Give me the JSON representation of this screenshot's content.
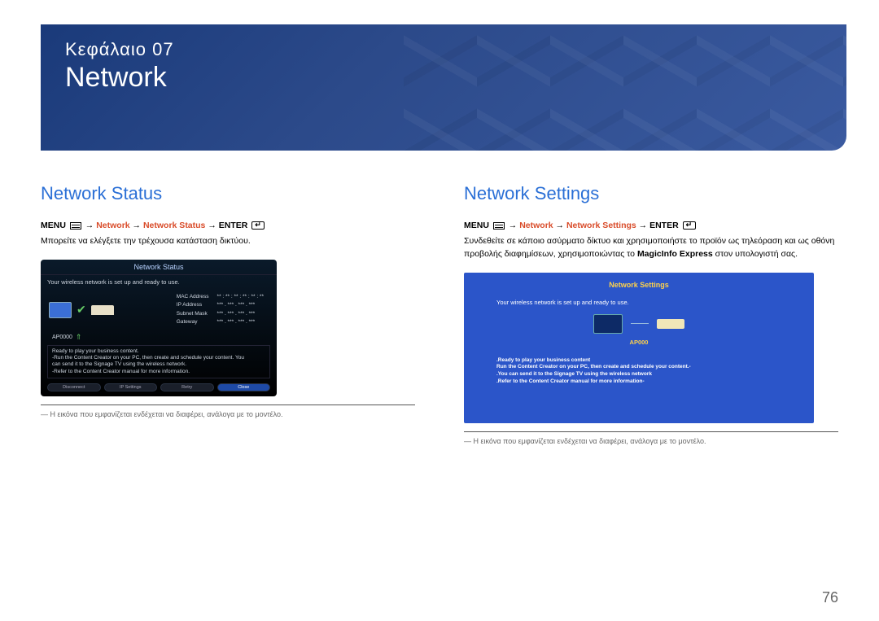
{
  "chapter": {
    "label": "Κεφάλαιο  07",
    "title": "Network"
  },
  "left": {
    "heading": "Network Status",
    "breadcrumb": {
      "menu": "MENU",
      "path": "Network",
      "item": "Network Status",
      "enter": "ENTER"
    },
    "desc": "Μπορείτε να ελέγξετε την τρέχουσα κατάσταση δικτύου.",
    "shot": {
      "title": "Network Status",
      "status_line": "Your wireless network is set up and ready to use.",
      "ap": "AP0000",
      "fields": {
        "mac": "MAC Address",
        "ip": "IP Address",
        "subnet": "Subnet Mask",
        "gateway": "Gateway"
      },
      "values": {
        "mac": "** : ** : ** : ** : ** : **",
        "ip": "*** . *** . *** . ***",
        "subnet": "*** . *** . *** . ***",
        "gateway": "*** . *** . *** . ***"
      },
      "ready_title": "Ready to play your business content.",
      "ready_l1": "-Run the Content Creator on your PC, then create and schedule your content. You",
      "ready_l2": "can send it to the Signage TV using the wireless network.",
      "ready_l3": "-Refer to the Content Creator manual for more information.",
      "btn_disconnect": "Disconnect",
      "btn_ip": "IP Settings",
      "btn_retry": "Retry",
      "btn_close": "Close"
    },
    "footnote": "― Η εικόνα που εμφανίζεται ενδέχεται να διαφέρει, ανάλογα με το μοντέλο."
  },
  "right": {
    "heading": "Network Settings",
    "breadcrumb": {
      "menu": "MENU",
      "path": "Network",
      "item": "Network Settings",
      "enter": "ENTER"
    },
    "desc_pre": "Συνδεθείτε σε κάποιο ασύρματο δίκτυο και χρησιμοποιήστε το προϊόν ως τηλεόραση και ως οθόνη προβολής διαφημίσεων, χρησιμοποιώντας το ",
    "desc_bold": "MagicInfo Express",
    "desc_post": " στον υπολογιστή σας.",
    "shot": {
      "title": "Network Settings",
      "status_line": "Your wireless network is set up and ready to use.",
      "ap": "AP000",
      "ready_title": ".Ready to play your business content",
      "ready_l1": "Run the Content Creator on your PC, then create and schedule your content.-",
      "ready_l2": ".You can send it to the Signage TV using the wireless network",
      "ready_l3": ".Refer to the Content Creator manual for more information-"
    },
    "footnote": "― Η εικόνα που εμφανίζεται ενδέχεται να διαφέρει, ανάλογα με το μοντέλο."
  },
  "page_number": "76"
}
